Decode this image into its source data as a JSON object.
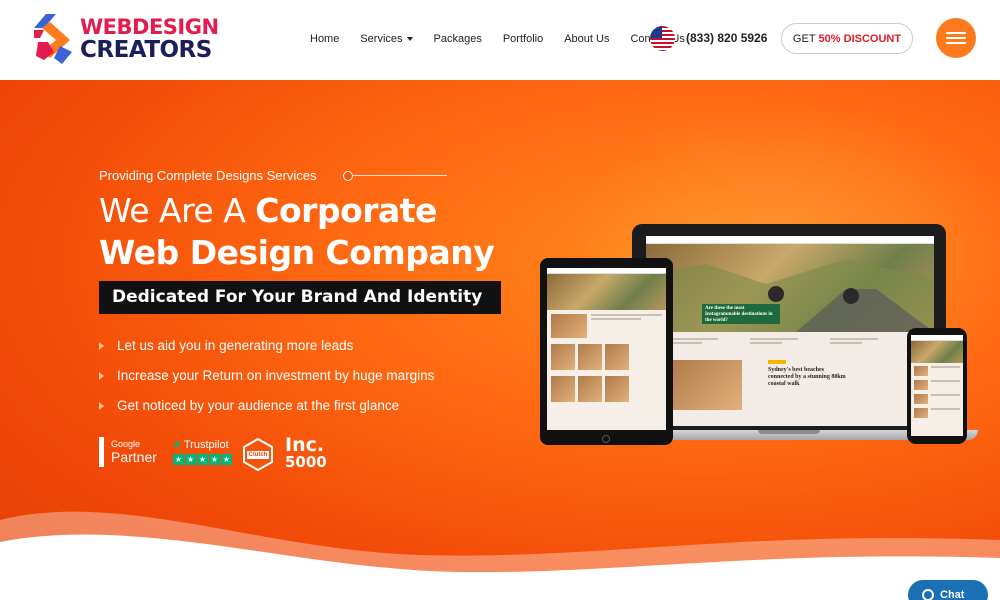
{
  "header": {
    "logo": {
      "line1": "WEBDESIGN",
      "line2": "CREATORS"
    },
    "nav": [
      {
        "label": "Home"
      },
      {
        "label": "Services",
        "has_dropdown": true
      },
      {
        "label": "Packages"
      },
      {
        "label": "Portfolio"
      },
      {
        "label": "About Us"
      },
      {
        "label": "Contact Us"
      }
    ],
    "phone": "(833) 820 5926",
    "discount_prefix": "GET",
    "discount_accent": "50% DISCOUNT"
  },
  "hero": {
    "eyebrow": "Providing Complete Designs Services",
    "heading_light": "We Are A",
    "heading_bold_1": "Corporate",
    "heading_bold_2": "Web Design Company",
    "tagline": "Dedicated For Your Brand And Identity",
    "bullets": [
      "Let us aid you in generating more leads",
      "Increase your Return on investment by huge margins",
      "Get noticed by your audience at the first glance"
    ],
    "badges": {
      "google_small": "Google",
      "google_large": "Partner",
      "trustpilot": "Trustpilot",
      "clutch": "Clutch",
      "inc_word": "Inc.",
      "inc_number": "5000"
    }
  },
  "mockup": {
    "laptop_headline": "Are these the most Instagrammable destinations in the world?",
    "laptop_story": "Sydney's best beaches connected by a stunning 80km coastal walk"
  },
  "chat": {
    "label": "Chat"
  },
  "colors": {
    "accent_orange": "#fe7a1f",
    "brand_red": "#e31b4f",
    "brand_navy": "#1d1d5c",
    "chat_blue": "#1b6fb5"
  }
}
